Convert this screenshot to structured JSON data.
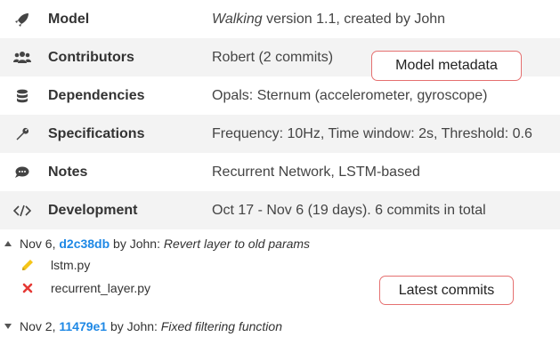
{
  "metadata": {
    "rows": [
      {
        "icon": "rocket-icon",
        "label": "Model",
        "value_em": "Walking",
        "value_rest": " version 1.1, created by John"
      },
      {
        "icon": "users-icon",
        "label": "Contributors",
        "value_em": "",
        "value_rest": "Robert (2 commits)"
      },
      {
        "icon": "database-icon",
        "label": "Dependencies",
        "value_em": "",
        "value_rest": "Opals: Sternum (accelerometer, gyroscope)"
      },
      {
        "icon": "wrench-icon",
        "label": "Specifications",
        "value_em": "",
        "value_rest": "Frequency: 10Hz, Time window: 2s, Threshold: 0.6"
      },
      {
        "icon": "comment-icon",
        "label": "Notes",
        "value_em": "",
        "value_rest": "Recurrent Network, LSTM-based"
      },
      {
        "icon": "code-icon",
        "label": "Development",
        "value_em": "",
        "value_rest": "Oct 17 - Nov 6 (19 days). 6 commits in total"
      }
    ]
  },
  "callouts": {
    "metadata": "Model metadata",
    "commits": "Latest commits"
  },
  "commits": [
    {
      "date": "Nov 6, ",
      "hash": "d2c38db",
      "by": " by John: ",
      "message": "Revert layer to old params",
      "expanded": true,
      "files": [
        {
          "icon": "pencil-icon",
          "name": "lstm.py",
          "status": "modified",
          "color": "#f5c518"
        },
        {
          "icon": "cross-icon",
          "name": "recurrent_layer.py",
          "status": "deleted",
          "color": "#e53935"
        }
      ]
    },
    {
      "date": "Nov 2, ",
      "hash": "11479e1",
      "by": " by John: ",
      "message": "Fixed filtering function",
      "expanded": false,
      "files": []
    }
  ],
  "colors": {
    "link": "#1e88e5",
    "callout_border": "#e57070",
    "row_shade": "#f3f3f3"
  }
}
